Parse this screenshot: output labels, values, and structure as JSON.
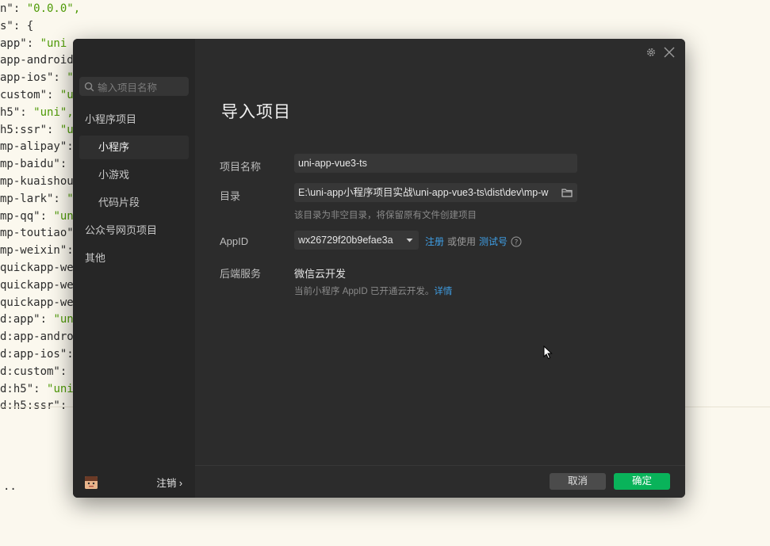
{
  "editor": {
    "lines": [
      [
        "n\": ",
        "\"0.0.0\","
      ],
      [
        "s\": {",
        ""
      ],
      [
        "app\": ",
        "\"uni"
      ],
      [
        "app-android",
        ""
      ],
      [
        "app-ios\": ",
        "\""
      ],
      [
        "custom\": ",
        "\"u"
      ],
      [
        "h5\": ",
        "\"uni\","
      ],
      [
        "h5:ssr\": ",
        "\"u"
      ],
      [
        "mp-alipay\":",
        ""
      ],
      [
        "mp-baidu\": ",
        ""
      ],
      [
        "mp-kuaishou",
        ""
      ],
      [
        "mp-lark\": ",
        "\""
      ],
      [
        "mp-qq\": ",
        "\"un"
      ],
      [
        "mp-toutiao\"",
        ""
      ],
      [
        "mp-weixin\":",
        ""
      ],
      [
        "quickapp-we",
        ""
      ],
      [
        "quickapp-we",
        ""
      ],
      [
        "quickapp-we",
        ""
      ],
      [
        "d:app\": ",
        "\"un"
      ],
      [
        "d:app-andro",
        ""
      ],
      [
        "d:app-ios\":",
        ""
      ],
      [
        "d:custom\": ",
        ""
      ],
      [
        "d:h5\": ",
        "\"uni"
      ],
      [
        "d:h5:ssr\":",
        ""
      ]
    ],
    "dots": ".."
  },
  "sidebar": {
    "search_placeholder": "输入项目名称",
    "items": [
      {
        "label": "小程序项目"
      },
      {
        "label": "小程序"
      },
      {
        "label": "小游戏"
      },
      {
        "label": "代码片段"
      },
      {
        "label": "公众号网页项目"
      },
      {
        "label": "其他"
      }
    ],
    "logout_label": "注销 ›"
  },
  "dialog": {
    "title": "导入项目",
    "project_name_label": "项目名称",
    "project_name_value": "uni-app-vue3-ts",
    "directory_label": "目录",
    "directory_value": "E:\\uni-app小程序项目实战\\uni-app-vue3-ts\\dist\\dev\\mp-w",
    "directory_hint": "该目录为非空目录，将保留原有文件创建项目",
    "appid_label": "AppID",
    "appid_value": "wx26729f20b9efae3a",
    "register_link": "注册",
    "or_use": "或使用",
    "test_account_link": "测试号",
    "backend_label": "后端服务",
    "backend_value": "微信云开发",
    "backend_hint": "当前小程序 AppID 已开通云开发。",
    "details_link": "详情",
    "cancel_label": "取消",
    "ok_label": "确定"
  },
  "colors": {
    "accent_green": "#09b35a",
    "link_blue": "#3f9fe6",
    "dialog_bg": "#2c2c2c",
    "sidebar_bg": "#262626"
  }
}
